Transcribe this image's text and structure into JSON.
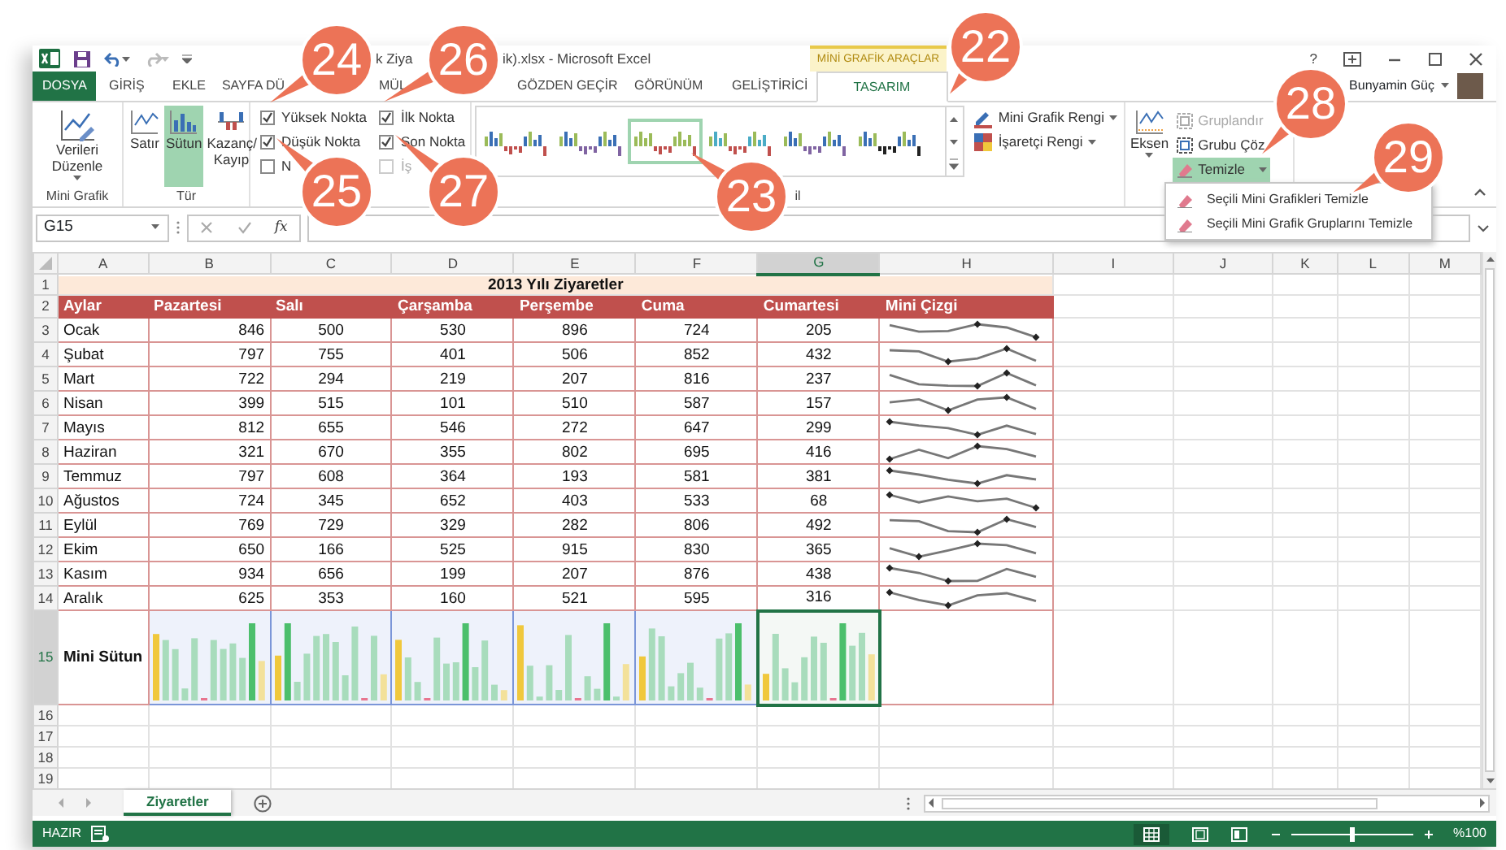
{
  "window": {
    "title_parts": [
      "k Ziya",
      "ik).xlsx - Microsoft Excel"
    ],
    "context_tab": "MİNİ GRAFİK ARAÇLAR",
    "help": "?",
    "user": "Bunyamin Güç"
  },
  "tabs": [
    {
      "label": "DOSYA",
      "kind": "file",
      "selected": false
    },
    {
      "label": "GİRİŞ",
      "kind": "tab",
      "selected": false
    },
    {
      "label": "EKLE",
      "kind": "tab",
      "selected": false
    },
    {
      "label": "SAYFA DÜ",
      "kind": "tab",
      "selected": false
    },
    {
      "label": "MÜL",
      "kind": "tab",
      "selected": false
    },
    {
      "label": "GÖZDEN GEÇİR",
      "kind": "tab",
      "selected": false
    },
    {
      "label": "GÖRÜNÜM",
      "kind": "tab",
      "selected": false
    },
    {
      "label": "GELİŞTİRİCİ",
      "kind": "tab",
      "selected": false
    },
    {
      "label": "TASARIM",
      "kind": "tab",
      "selected": true
    }
  ],
  "ribbon": {
    "edit_data": {
      "label": "Verileri Düzenle",
      "group": "Mini Grafik"
    },
    "types": {
      "group": "Tür",
      "items": [
        {
          "label": "Satır",
          "kind": "line",
          "selected": false
        },
        {
          "label": "Sütun",
          "kind": "column",
          "selected": true
        },
        {
          "label": "Kazanç/ Kayıp",
          "kind": "winloss",
          "selected": false
        }
      ]
    },
    "show": [
      {
        "label": "Yüksek Nokta",
        "checked": true,
        "disabled": false
      },
      {
        "label": "Düşük Nokta",
        "checked": true,
        "disabled": false
      },
      {
        "label": "N",
        "checked": false,
        "disabled": false
      },
      {
        "label": "İlk Nokta",
        "checked": true,
        "disabled": false
      },
      {
        "label": "Son Nokta",
        "checked": true,
        "disabled": false
      },
      {
        "label": "İş",
        "checked": false,
        "disabled": true
      }
    ],
    "styles": {
      "group": "il",
      "items": [
        {
          "selected": false
        },
        {
          "selected": false
        },
        {
          "selected": true
        },
        {
          "selected": false
        },
        {
          "selected": false
        },
        {
          "selected": false
        }
      ]
    },
    "color_buttons": [
      {
        "label": "Mini Grafik Rengi",
        "kind": "pen"
      },
      {
        "label": "İşaretçi Rengi",
        "kind": "marker"
      }
    ],
    "axis": {
      "label": "Eksen"
    },
    "group_buttons": [
      {
        "label": "Gruplandır",
        "kind": "group",
        "disabled": true,
        "expanded": false
      },
      {
        "label": "Grubu Çöz",
        "kind": "ungroup",
        "disabled": false,
        "expanded": false
      },
      {
        "label": "Temizle",
        "kind": "clear",
        "disabled": false,
        "expanded": true
      }
    ],
    "clear_menu": [
      "Seçili Mini Grafikleri Temizle",
      "Seçili Mini Grafik Gruplarını Temizle"
    ]
  },
  "formula_bar": {
    "name_box": "G15",
    "function_label": "fx"
  },
  "sheet": {
    "columns": [
      {
        "label": "A",
        "selected": false
      },
      {
        "label": "B",
        "selected": false
      },
      {
        "label": "C",
        "selected": false
      },
      {
        "label": "D",
        "selected": false
      },
      {
        "label": "E",
        "selected": false
      },
      {
        "label": "F",
        "selected": false
      },
      {
        "label": "G",
        "selected": true
      },
      {
        "label": "H",
        "selected": false
      },
      {
        "label": "I",
        "selected": false
      },
      {
        "label": "J",
        "selected": false
      },
      {
        "label": "K",
        "selected": false
      },
      {
        "label": "L",
        "selected": false
      },
      {
        "label": "M",
        "selected": false
      }
    ],
    "row_headers": [
      {
        "label": "1",
        "selected": false
      },
      {
        "label": "2",
        "selected": false
      },
      {
        "label": "3",
        "selected": false
      },
      {
        "label": "4",
        "selected": false
      },
      {
        "label": "5",
        "selected": false
      },
      {
        "label": "6",
        "selected": false
      },
      {
        "label": "7",
        "selected": false
      },
      {
        "label": "8",
        "selected": false
      },
      {
        "label": "9",
        "selected": false
      },
      {
        "label": "10",
        "selected": false
      },
      {
        "label": "11",
        "selected": false
      },
      {
        "label": "12",
        "selected": false
      },
      {
        "label": "13",
        "selected": false
      },
      {
        "label": "14",
        "selected": false
      },
      {
        "label": "15",
        "selected": true
      },
      {
        "label": "16",
        "selected": false
      },
      {
        "label": "17",
        "selected": false
      },
      {
        "label": "18",
        "selected": false
      },
      {
        "label": "19",
        "selected": false
      }
    ],
    "title": "2013 Yılı Ziyaretler",
    "headers": [
      "Aylar",
      "Pazartesi",
      "Salı",
      "Çarşamba",
      "Perşembe",
      "Cuma",
      "Cumartesi",
      "Mini Çizgi"
    ],
    "rows": [
      {
        "month": "Ocak",
        "values": [
          "846",
          "500",
          "530",
          "896",
          "724",
          "205"
        ]
      },
      {
        "month": "Şubat",
        "values": [
          "797",
          "755",
          "401",
          "506",
          "852",
          "432"
        ]
      },
      {
        "month": "Mart",
        "values": [
          "722",
          "294",
          "219",
          "207",
          "816",
          "237"
        ]
      },
      {
        "month": "Nisan",
        "values": [
          "399",
          "515",
          "101",
          "510",
          "587",
          "157"
        ]
      },
      {
        "month": "Mayıs",
        "values": [
          "812",
          "655",
          "546",
          "272",
          "647",
          "299"
        ]
      },
      {
        "month": "Haziran",
        "values": [
          "321",
          "670",
          "355",
          "802",
          "695",
          "416"
        ]
      },
      {
        "month": "Temmuz",
        "values": [
          "797",
          "608",
          "364",
          "193",
          "581",
          "381"
        ]
      },
      {
        "month": "Ağustos",
        "values": [
          "724",
          "345",
          "652",
          "403",
          "533",
          "68"
        ]
      },
      {
        "month": "Eylül",
        "values": [
          "769",
          "729",
          "329",
          "282",
          "806",
          "492"
        ]
      },
      {
        "month": "Ekim",
        "values": [
          "650",
          "166",
          "525",
          "915",
          "830",
          "365"
        ]
      },
      {
        "month": "Kasım",
        "values": [
          "934",
          "656",
          "199",
          "207",
          "876",
          "438"
        ]
      },
      {
        "month": "Aralık",
        "values": [
          "625",
          "353",
          "160",
          "521",
          "595",
          "316"
        ]
      }
    ],
    "footer_label": "Mini Sütun"
  },
  "sheet_tabs": [
    {
      "label": "Ziyaretler",
      "selected": true
    }
  ],
  "status_bar": {
    "text": "HAZIR",
    "zoom_slider": {
      "level": 0.5
    },
    "zoom": "%100"
  },
  "callouts": [
    {
      "label": "24"
    },
    {
      "label": "26"
    },
    {
      "label": "22"
    },
    {
      "label": "28"
    },
    {
      "label": "29"
    },
    {
      "label": "25"
    },
    {
      "label": "27"
    },
    {
      "label": "23"
    }
  ]
}
